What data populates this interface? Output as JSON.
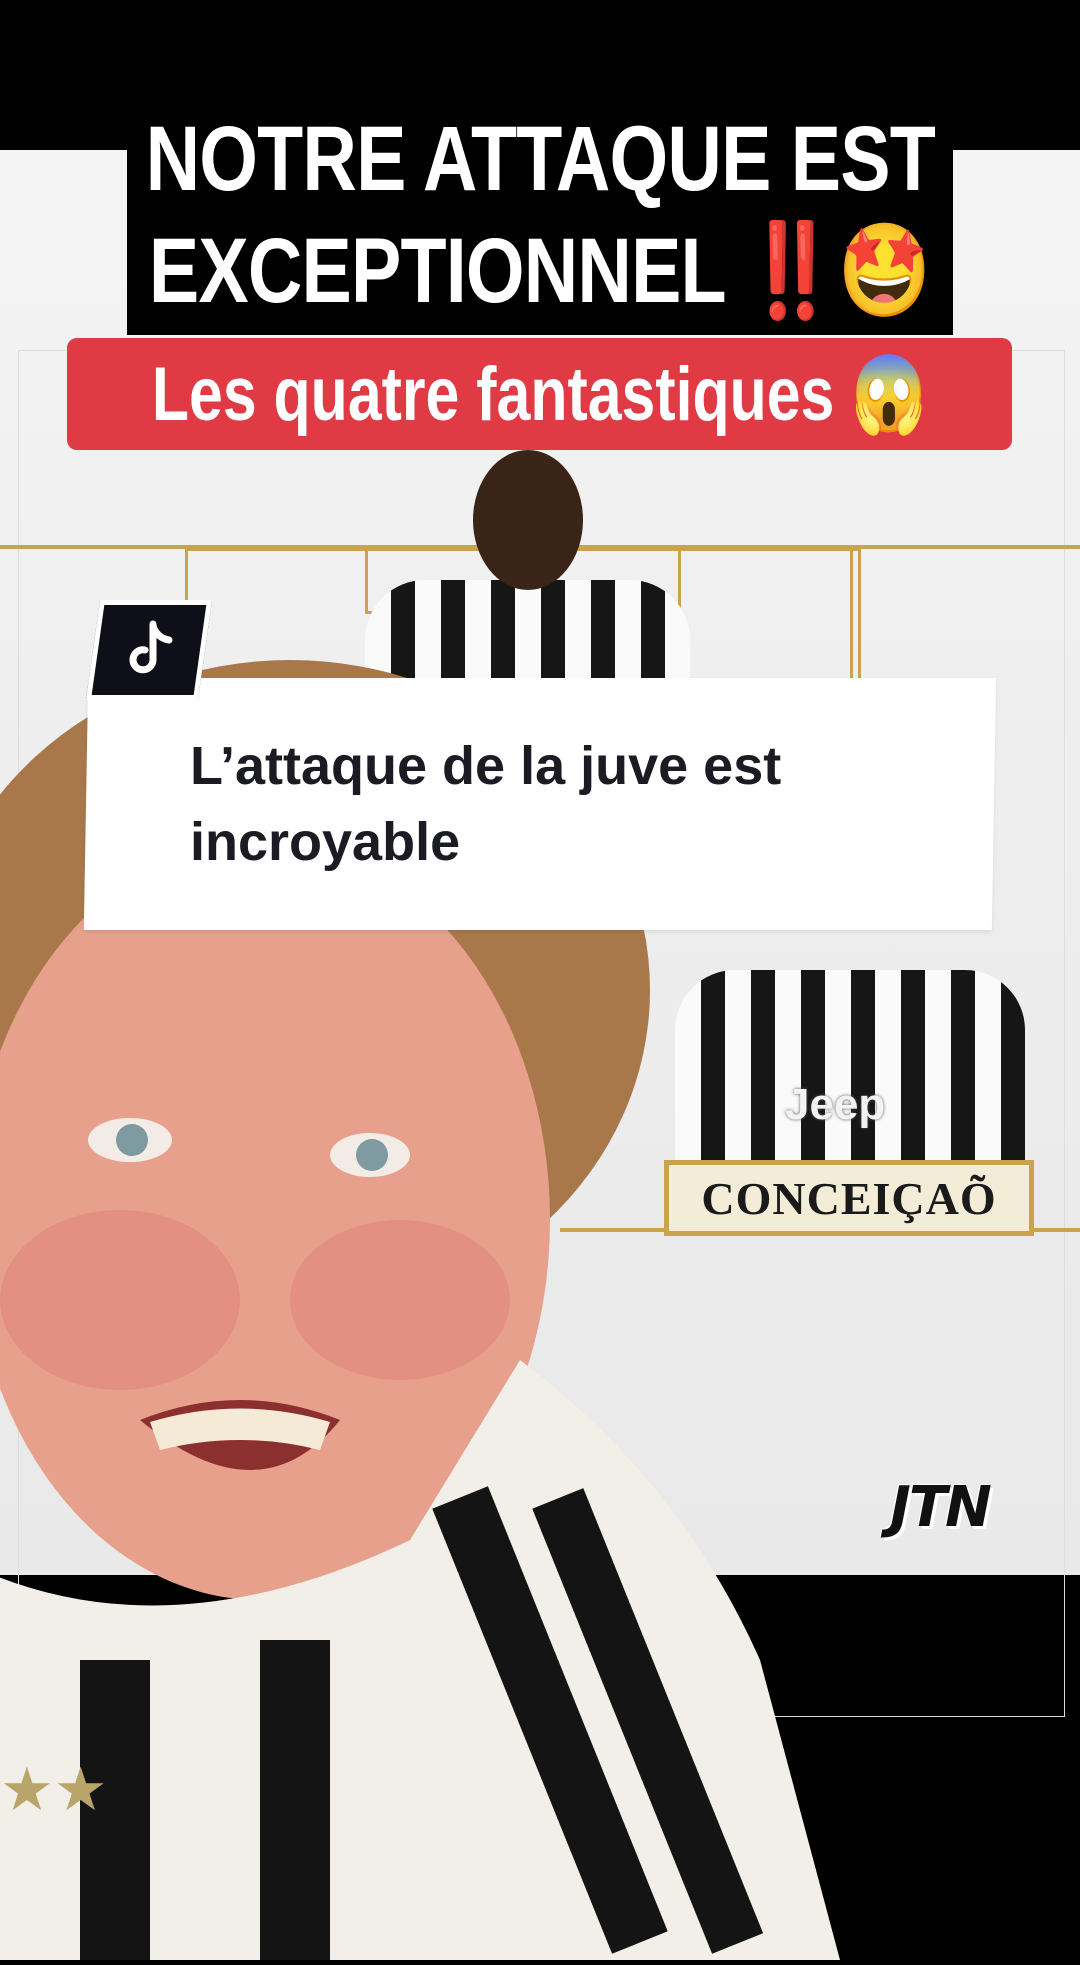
{
  "video": {
    "title_line1": "NOTRE ATTAQUE EST",
    "title_line2": "EXCEPTIONNEL ‼️🤩",
    "subtitle": "Les quatre fantastiques 😱",
    "comment_reply": "L’attaque de la juve est incroyable",
    "player_name": "CONCEIÇAÕ",
    "watermark": "JTN",
    "shirt_sponsor": "Jeep"
  },
  "icons": {
    "tiktok": "tiktok-logo-icon"
  },
  "colors": {
    "banner_red": "#e03a45",
    "gold": "#c9a44c",
    "title_bg": "#000000"
  }
}
